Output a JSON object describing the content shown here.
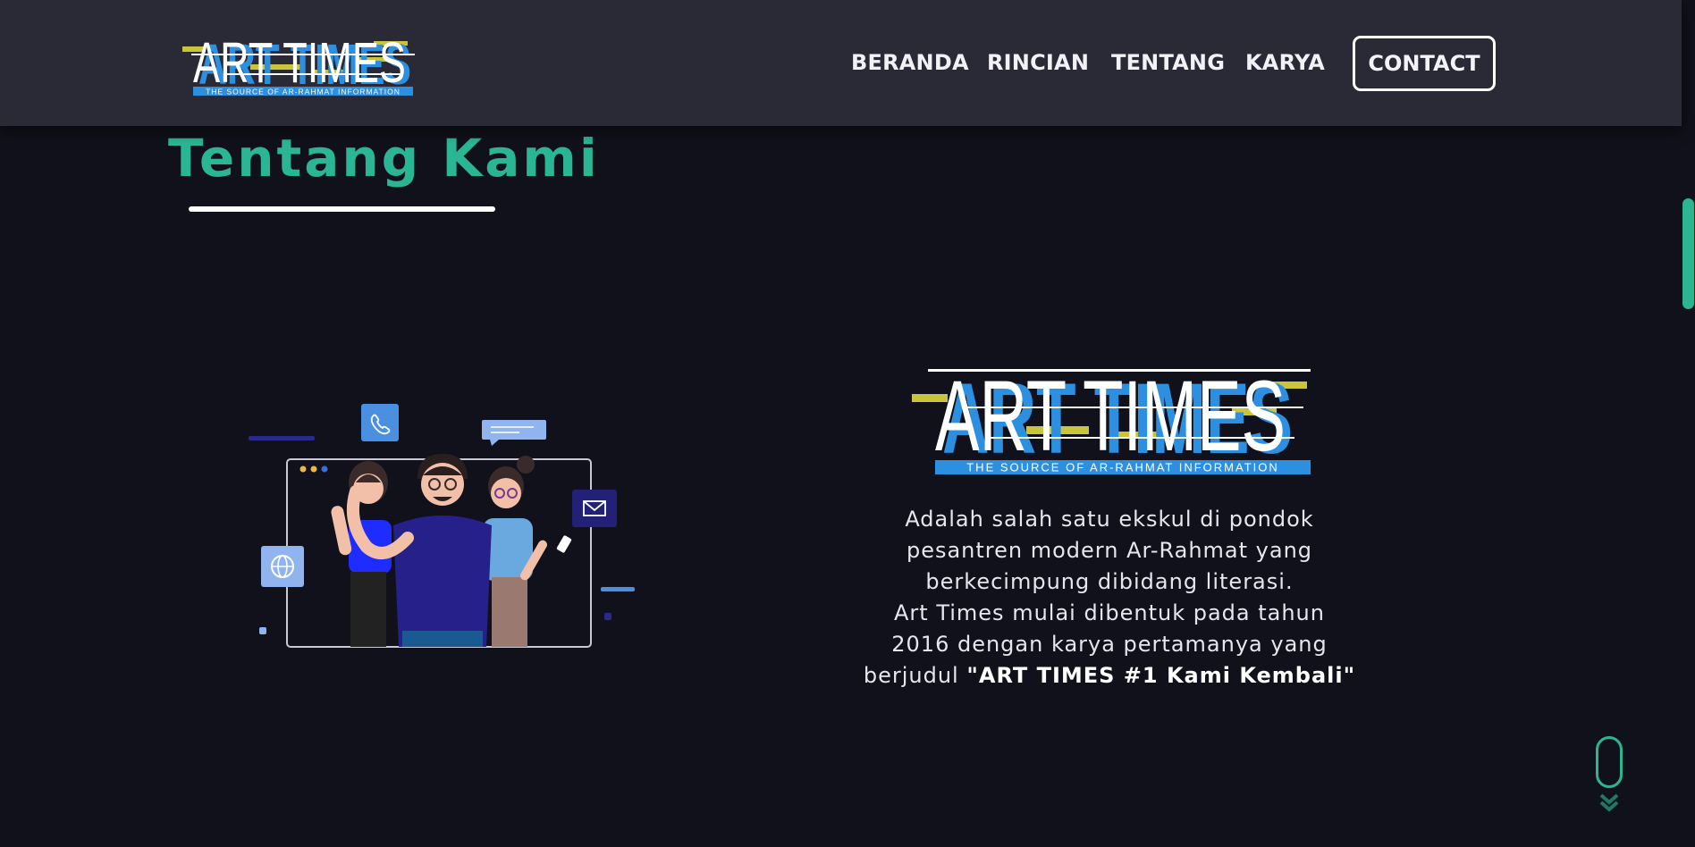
{
  "header": {
    "logo": {
      "text": "ART TIMES",
      "tagline": "THE SOURCE OF AR-RAHMAT INFORMATION"
    },
    "nav": [
      {
        "label": "BERANDA"
      },
      {
        "label": "RINCIAN"
      },
      {
        "label": "TENTANG"
      },
      {
        "label": "KARYA"
      }
    ],
    "contact_label": "CONTACT"
  },
  "about": {
    "title": "Tentang Kami",
    "logo": {
      "text": "ART TIMES",
      "tagline": "THE SOURCE OF AR-RAHMAT INFORMATION"
    },
    "description_lines": [
      "Adalah salah satu ekskul di pondok",
      "pesantren modern Ar-Rahmat yang",
      "berkecimpung dibidang literasi.",
      "Art Times mulai dibentuk pada tahun",
      "2016 dengan karya pertamanya yang"
    ],
    "last_line_prefix": "berjudul ",
    "work_title": "\"ART TIMES #1 Kami Kembali\""
  },
  "colors": {
    "accent": "#2ab694",
    "header_bg": "#2a2936",
    "page_bg": "#11111c",
    "logo_blue": "#2d8fe0",
    "logo_yellow": "#c9c43a"
  }
}
